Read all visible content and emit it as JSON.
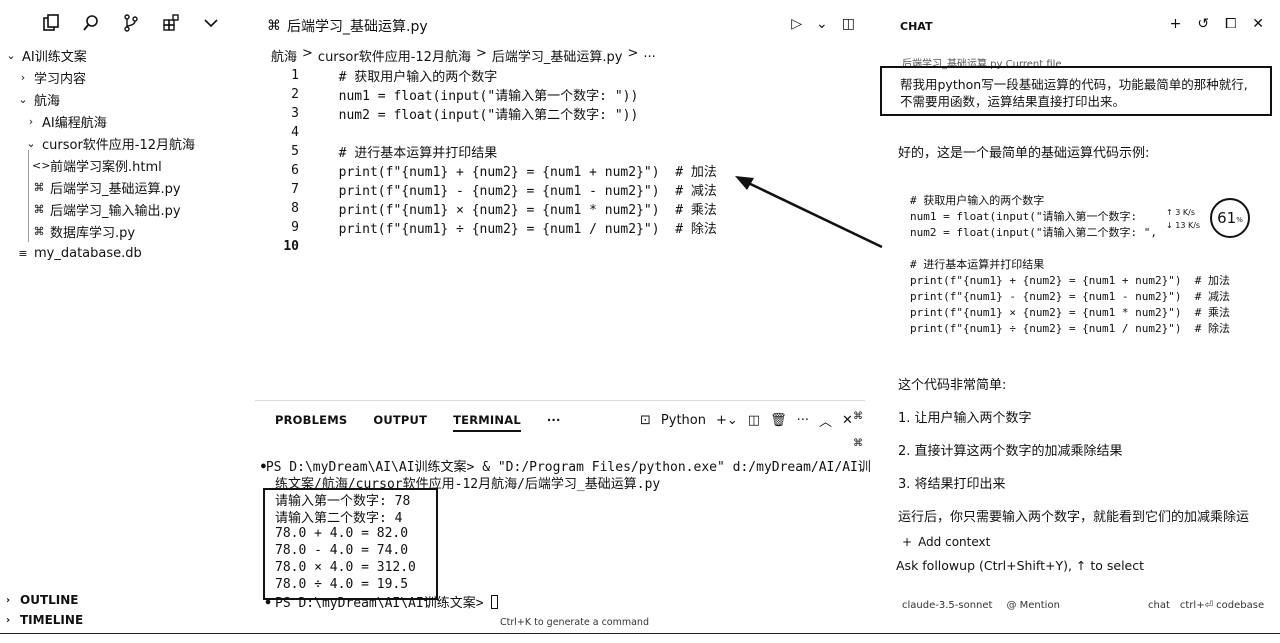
{
  "activity_bar": {
    "icons": [
      "files-icon",
      "search-icon",
      "source-control-icon",
      "extensions-icon",
      "chevron-down-icon"
    ]
  },
  "explorer": {
    "root": "AI训练文案",
    "items": [
      {
        "label": "学习内容",
        "kind": "folder",
        "expanded": false,
        "depth": 1
      },
      {
        "label": "航海",
        "kind": "folder",
        "expanded": true,
        "depth": 1
      },
      {
        "label": "AI编程航海",
        "kind": "folder",
        "expanded": false,
        "depth": 2
      },
      {
        "label": "cursor软件应用-12月航海",
        "kind": "folder",
        "expanded": true,
        "depth": 2
      },
      {
        "label": "前端学习案例.html",
        "kind": "html",
        "depth": 3
      },
      {
        "label": "后端学习_基础运算.py",
        "kind": "py",
        "depth": 3
      },
      {
        "label": "后端学习_输入输出.py",
        "kind": "py",
        "depth": 3
      },
      {
        "label": "数据库学习.py",
        "kind": "py",
        "depth": 3
      },
      {
        "label": "my_database.db",
        "kind": "db",
        "depth": 1
      }
    ],
    "outline": "OUTLINE",
    "timeline": "TIMELINE"
  },
  "editor": {
    "tab_title": "后端学习_基础运算.py",
    "breadcrumb": [
      "航海",
      ">",
      "cursor软件应用-12月航海",
      ">",
      "后端学习_基础运算.py",
      ">",
      "..."
    ],
    "lines": [
      {
        "n": "1",
        "text": "  # 获取用户输入的两个数字"
      },
      {
        "n": "2",
        "text": "  num1 = float(input(\"请输入第一个数字: \"))"
      },
      {
        "n": "3",
        "text": "  num2 = float(input(\"请输入第二个数字: \"))"
      },
      {
        "n": "4",
        "text": ""
      },
      {
        "n": "5",
        "text": "  # 进行基本运算并打印结果"
      },
      {
        "n": "6",
        "text": "  print(f\"{num1} + {num2} = {num1 + num2}\")  # 加法"
      },
      {
        "n": "7",
        "text": "  print(f\"{num1} - {num2} = {num1 - num2}\")  # 减法"
      },
      {
        "n": "8",
        "text": "  print(f\"{num1} × {num2} = {num1 * num2}\")  # 乘法"
      },
      {
        "n": "9",
        "text": "  print(f\"{num1} ÷ {num2} = {num1 / num2}\")  # 除法"
      },
      {
        "n": "10",
        "text": ""
      }
    ]
  },
  "panel": {
    "tabs": [
      "PROBLEMS",
      "OUTPUT",
      "TERMINAL"
    ],
    "more": "···",
    "shell": "Python",
    "terminal": {
      "cmd_line1": "PS D:\\myDream\\AI\\AI训练文案> & \"D:/Program Files/python.exe\" d:/myDream/AI/AI训",
      "cmd_line2": "练文案/航海/cursor软件应用-12月航海/后端学习_基础运算.py",
      "output": [
        "请输入第一个数字: 78",
        "请输入第二个数字: 4",
        "78.0 + 4.0 = 82.0",
        "78.0 - 4.0 = 74.0",
        "78.0 × 4.0 = 312.0",
        "78.0 ÷ 4.0 = 19.5"
      ],
      "prompt": "PS D:\\myDream\\AI\\AI训练文案> "
    },
    "hint": "Ctrl+K to generate a command"
  },
  "chat": {
    "header": "CHAT",
    "context_file": "后端学习_基础运算.py Current file",
    "user_prompt_line1": "帮我用python写一段基础运算的代码，功能最简单的那种就行,",
    "user_prompt_line2": "不需要用函数，运算结果直接打印出来。",
    "intro": "好的，这是一个最简单的基础运算代码示例:",
    "code": [
      "# 获取用户输入的两个数字",
      "num1 = float(input(\"请输入第一个数字: ",
      "num2 = float(input(\"请输入第二个数字: \",",
      "",
      "# 进行基本运算并打印结果",
      "print(f\"{num1} + {num2} = {num1 + num2}\")  # 加法",
      "print(f\"{num1} - {num2} = {num1 - num2}\")  # 减法",
      "print(f\"{num1} × {num2} = {num1 * num2}\")  # 乘法",
      "print(f\"{num1} ÷ {num2} = {num1 / num2}\")  # 除法"
    ],
    "speed_up": "↑ 3  K/s",
    "speed_down": "↓ 13  K/s",
    "gauge_value": "61",
    "gauge_unit": "%",
    "explain_title": "这个代码非常简单:",
    "points": [
      "1. 让用户输入两个数字",
      "2. 直接计算这两个数字的加减乘除结果",
      "3. 将结果打印出来"
    ],
    "closing": "运行后，你只需要输入两个数字，就能看到它们的加减乘除运",
    "add_context": "Add context",
    "followup": "Ask followup (Ctrl+Shift+Y), ↑ to select",
    "model": "claude-3.5-sonnet",
    "mention": "@ Mention",
    "chat_btn": "chat",
    "codebase": "ctrl+⏎ codebase"
  }
}
